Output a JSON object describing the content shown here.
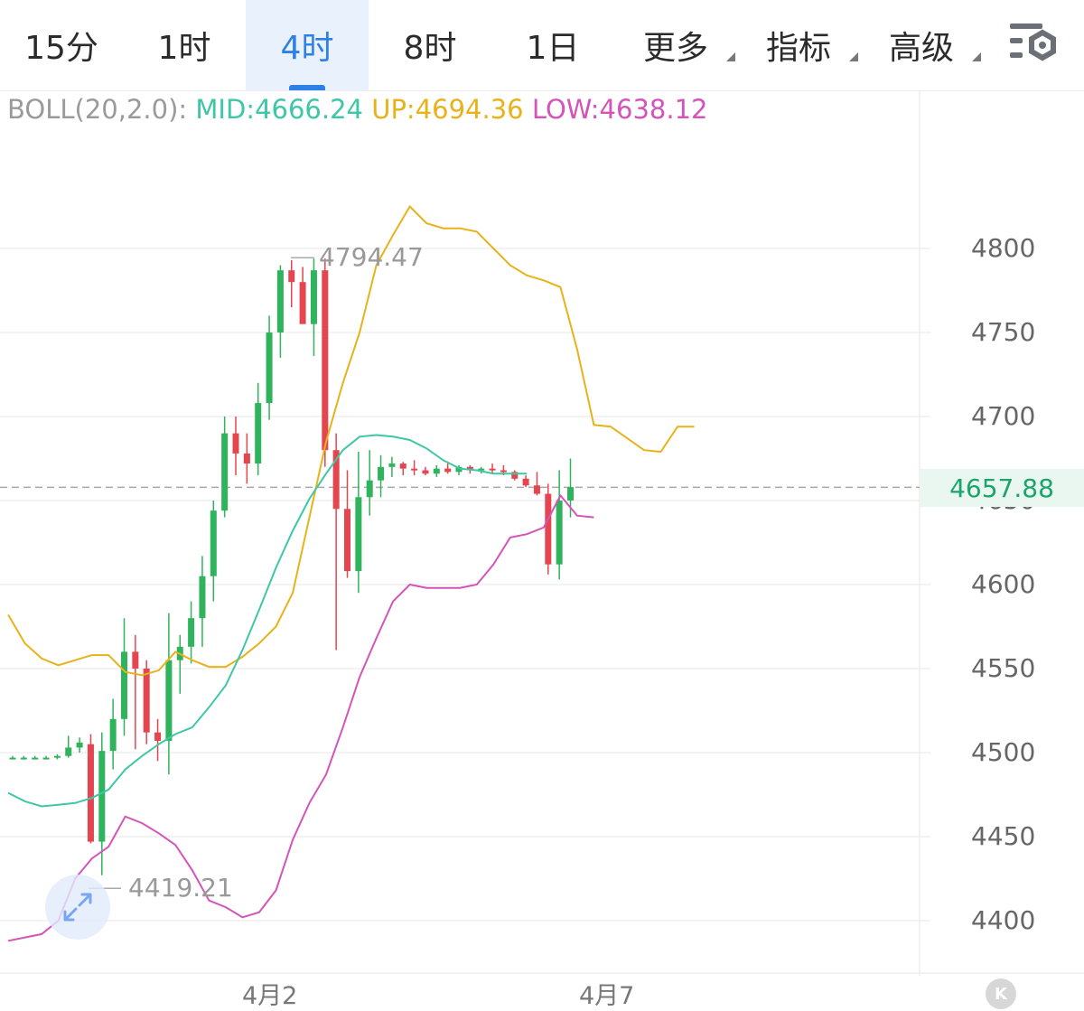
{
  "tabs": [
    {
      "label": "15分",
      "active": false,
      "has_menu": false
    },
    {
      "label": "1时",
      "active": false,
      "has_menu": false
    },
    {
      "label": "4时",
      "active": true,
      "has_menu": false
    },
    {
      "label": "8时",
      "active": false,
      "has_menu": false
    },
    {
      "label": "1日",
      "active": false,
      "has_menu": false
    },
    {
      "label": "更多",
      "active": false,
      "has_menu": true
    },
    {
      "label": "指标",
      "active": false,
      "has_menu": true
    },
    {
      "label": "高级",
      "active": false,
      "has_menu": true
    }
  ],
  "settings_icon": "chart-settings-icon",
  "boll": {
    "prefix": "BOLL(20,2.0):",
    "mid": "MID:4666.24",
    "up": "UP:4694.36",
    "low": "LOW:4638.12"
  },
  "current_price": "4657.88",
  "high_label": "4794.47",
  "low_label": "4419.21",
  "x_labels": [
    "4月2",
    "4月7"
  ],
  "k_badge": "K",
  "colors": {
    "accent": "#2e80e6",
    "up": "#2fb35c",
    "down": "#e5454f",
    "mid": "#3ec7a6",
    "upper": "#e8b21a",
    "lower": "#d454b8",
    "boll_prefix": "#9a9a9a"
  },
  "chart_data": {
    "type": "candlestick",
    "indicator": "BOLL(20,2.0)",
    "y_ticks": [
      4800,
      4750,
      4700,
      4650,
      4600,
      4550,
      4500,
      4450,
      4400
    ],
    "ylim": [
      4375,
      4840
    ],
    "grid": true,
    "current_price": 4657.88,
    "x_labels": [
      {
        "label": "4月2",
        "index": 24
      },
      {
        "label": "4月7",
        "index": 54
      }
    ],
    "candles": [
      [
        4497,
        4498,
        4496,
        4497
      ],
      [
        4497,
        4498,
        4496,
        4497
      ],
      [
        4497,
        4498,
        4496,
        4497
      ],
      [
        4497,
        4498,
        4496,
        4497
      ],
      [
        4497,
        4499,
        4496,
        4498
      ],
      [
        4498,
        4510,
        4497,
        4503
      ],
      [
        4503,
        4509,
        4500,
        4506
      ],
      [
        4505,
        4511,
        4446,
        4447
      ],
      [
        4447,
        4512,
        4427,
        4501
      ],
      [
        4501,
        4532,
        4490,
        4520
      ],
      [
        4520,
        4580,
        4510,
        4560
      ],
      [
        4560,
        4570,
        4502,
        4550
      ],
      [
        4550,
        4555,
        4505,
        4512
      ],
      [
        4512,
        4520,
        4495,
        4507
      ],
      [
        4507,
        4583,
        4487,
        4555
      ],
      [
        4555,
        4570,
        4535,
        4563
      ],
      [
        4563,
        4590,
        4553,
        4580
      ],
      [
        4580,
        4617,
        4563,
        4605
      ],
      [
        4605,
        4650,
        4590,
        4644
      ],
      [
        4644,
        4700,
        4640,
        4690
      ],
      [
        4690,
        4700,
        4665,
        4678
      ],
      [
        4678,
        4690,
        4660,
        4672
      ],
      [
        4672,
        4720,
        4665,
        4708
      ],
      [
        4708,
        4760,
        4698,
        4750
      ],
      [
        4750,
        4790,
        4735,
        4787
      ],
      [
        4787,
        4793,
        4765,
        4780
      ],
      [
        4780,
        4789,
        4763,
        4755
      ],
      [
        4755,
        4794,
        4736,
        4787
      ],
      [
        4787,
        4794,
        4670,
        4680
      ],
      [
        4680,
        4690,
        4561,
        4645
      ],
      [
        4645,
        4668,
        4604,
        4608
      ],
      [
        4608,
        4679,
        4595,
        4652
      ],
      [
        4652,
        4680,
        4641,
        4662
      ],
      [
        4662,
        4677,
        4652,
        4670
      ],
      [
        4670,
        4676,
        4664,
        4672
      ],
      [
        4672,
        4673,
        4665,
        4669
      ],
      [
        4669,
        4674,
        4665,
        4668
      ],
      [
        4668,
        4670,
        4665,
        4666
      ],
      [
        4666,
        4671,
        4664,
        4669
      ],
      [
        4669,
        4672,
        4666,
        4667
      ],
      [
        4667,
        4671,
        4665,
        4670
      ],
      [
        4670,
        4671,
        4666,
        4668
      ],
      [
        4668,
        4670,
        4666,
        4669
      ],
      [
        4669,
        4672,
        4666,
        4668
      ],
      [
        4668,
        4671,
        4665,
        4667
      ],
      [
        4667,
        4668,
        4662,
        4663
      ],
      [
        4663,
        4665,
        4658,
        4659
      ],
      [
        4659,
        4667,
        4653,
        4654
      ],
      [
        4654,
        4660,
        4606,
        4612
      ],
      [
        4612,
        4668,
        4603,
        4650
      ],
      [
        4650,
        4675,
        4640,
        4658
      ]
    ],
    "boll_upper_pts": [
      [
        0,
        4582
      ],
      [
        1,
        4565
      ],
      [
        2,
        4556
      ],
      [
        3,
        4552
      ],
      [
        4,
        4555
      ],
      [
        5,
        4558
      ],
      [
        6,
        4558
      ],
      [
        7,
        4548
      ],
      [
        8,
        4546
      ],
      [
        9,
        4549
      ],
      [
        10,
        4560
      ],
      [
        11,
        4555
      ],
      [
        12,
        4551
      ],
      [
        13,
        4551
      ],
      [
        14,
        4557
      ],
      [
        15,
        4565
      ],
      [
        16,
        4575
      ],
      [
        17,
        4595
      ],
      [
        18,
        4640
      ],
      [
        19,
        4685
      ],
      [
        20,
        4720
      ],
      [
        21,
        4750
      ],
      [
        22,
        4790
      ],
      [
        23,
        4808
      ],
      [
        24,
        4825
      ],
      [
        25,
        4815
      ],
      [
        26,
        4812
      ],
      [
        27,
        4812
      ],
      [
        28,
        4810
      ],
      [
        29,
        4800
      ],
      [
        30,
        4790
      ],
      [
        31,
        4784
      ],
      [
        32,
        4781
      ],
      [
        33,
        4777
      ],
      [
        34,
        4740
      ],
      [
        35,
        4695
      ],
      [
        36,
        4694
      ],
      [
        37,
        4687
      ],
      [
        38,
        4680
      ],
      [
        39,
        4679
      ],
      [
        40,
        4694
      ],
      [
        41,
        4694
      ]
    ],
    "boll_mid_pts": [
      [
        0,
        4476
      ],
      [
        1,
        4471
      ],
      [
        2,
        4468
      ],
      [
        3,
        4469
      ],
      [
        4,
        4470
      ],
      [
        5,
        4473
      ],
      [
        6,
        4478
      ],
      [
        7,
        4490
      ],
      [
        8,
        4498
      ],
      [
        9,
        4505
      ],
      [
        10,
        4511
      ],
      [
        11,
        4515
      ],
      [
        12,
        4527
      ],
      [
        13,
        4540
      ],
      [
        14,
        4561
      ],
      [
        15,
        4585
      ],
      [
        16,
        4610
      ],
      [
        17,
        4632
      ],
      [
        18,
        4651
      ],
      [
        19,
        4666
      ],
      [
        20,
        4680
      ],
      [
        21,
        4688
      ],
      [
        22,
        4689
      ],
      [
        23,
        4688
      ],
      [
        24,
        4686
      ],
      [
        25,
        4681
      ],
      [
        26,
        4674
      ],
      [
        27,
        4669
      ],
      [
        28,
        4668
      ],
      [
        29,
        4666
      ],
      [
        30,
        4666
      ],
      [
        31,
        4666
      ]
    ],
    "boll_lower_pts": [
      [
        0,
        4388
      ],
      [
        1,
        4390
      ],
      [
        2,
        4392
      ],
      [
        3,
        4400
      ],
      [
        4,
        4425
      ],
      [
        5,
        4437
      ],
      [
        6,
        4444
      ],
      [
        7,
        4462
      ],
      [
        8,
        4458
      ],
      [
        9,
        4452
      ],
      [
        10,
        4445
      ],
      [
        11,
        4430
      ],
      [
        12,
        4412
      ],
      [
        13,
        4408
      ],
      [
        14,
        4402
      ],
      [
        15,
        4405
      ],
      [
        16,
        4418
      ],
      [
        17,
        4448
      ],
      [
        18,
        4470
      ],
      [
        19,
        4487
      ],
      [
        20,
        4515
      ],
      [
        21,
        4545
      ],
      [
        22,
        4568
      ],
      [
        23,
        4590
      ],
      [
        24,
        4600
      ],
      [
        25,
        4598
      ],
      [
        26,
        4598
      ],
      [
        27,
        4598
      ],
      [
        28,
        4600
      ],
      [
        29,
        4612
      ],
      [
        30,
        4628
      ],
      [
        31,
        4630
      ],
      [
        32,
        4634
      ],
      [
        33,
        4653
      ],
      [
        34,
        4641
      ],
      [
        35,
        4640
      ]
    ]
  }
}
